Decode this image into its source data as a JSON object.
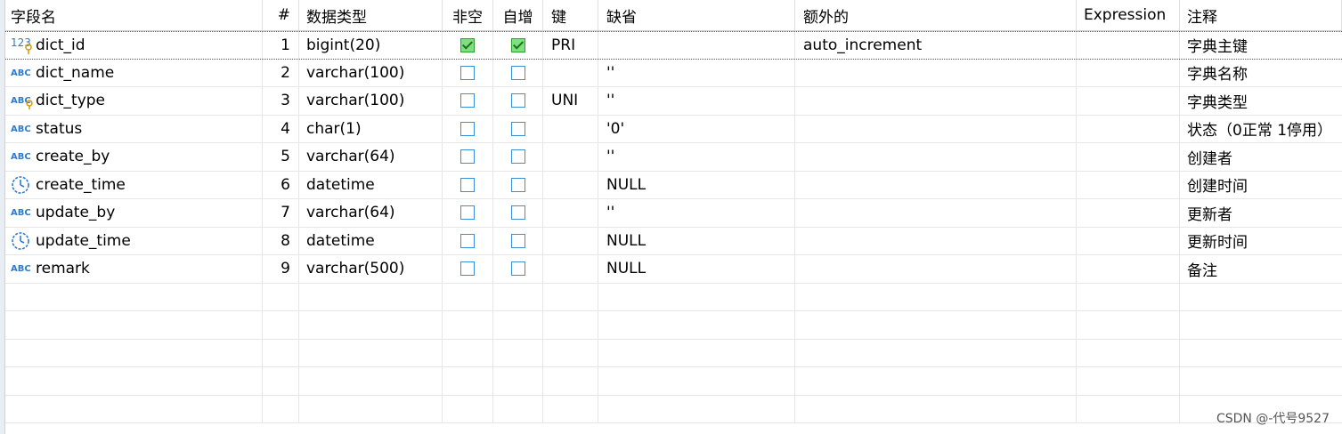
{
  "headers": {
    "name": "字段名",
    "num": "#",
    "type": "数据类型",
    "notnull": "非空",
    "autoinc": "自增",
    "key": "键",
    "default": "缺省",
    "extra": "额外的",
    "expression": "Expression",
    "comment": "注释"
  },
  "rows": [
    {
      "icon": "numeric-key-icon",
      "name": "dict_id",
      "num": "1",
      "type": "bigint(20)",
      "notnull": true,
      "autoinc": true,
      "key": "PRI",
      "default": "",
      "extra": "auto_increment",
      "expression": "",
      "comment": "字典主键"
    },
    {
      "icon": "text-abc-icon",
      "name": "dict_name",
      "num": "2",
      "type": "varchar(100)",
      "notnull": false,
      "autoinc": false,
      "key": "",
      "default": "''",
      "extra": "",
      "expression": "",
      "comment": "字典名称"
    },
    {
      "icon": "text-key-icon",
      "name": "dict_type",
      "num": "3",
      "type": "varchar(100)",
      "notnull": false,
      "autoinc": false,
      "key": "UNI",
      "default": "''",
      "extra": "",
      "expression": "",
      "comment": "字典类型"
    },
    {
      "icon": "text-abc-icon",
      "name": "status",
      "num": "4",
      "type": "char(1)",
      "notnull": false,
      "autoinc": false,
      "key": "",
      "default": "'0'",
      "extra": "",
      "expression": "",
      "comment": "状态（0正常 1停用）"
    },
    {
      "icon": "text-abc-icon",
      "name": "create_by",
      "num": "5",
      "type": "varchar(64)",
      "notnull": false,
      "autoinc": false,
      "key": "",
      "default": "''",
      "extra": "",
      "expression": "",
      "comment": "创建者"
    },
    {
      "icon": "clock-icon",
      "name": "create_time",
      "num": "6",
      "type": "datetime",
      "notnull": false,
      "autoinc": false,
      "key": "",
      "default": "NULL",
      "extra": "",
      "expression": "",
      "comment": "创建时间"
    },
    {
      "icon": "text-abc-icon",
      "name": "update_by",
      "num": "7",
      "type": "varchar(64)",
      "notnull": false,
      "autoinc": false,
      "key": "",
      "default": "''",
      "extra": "",
      "expression": "",
      "comment": "更新者"
    },
    {
      "icon": "clock-icon",
      "name": "update_time",
      "num": "8",
      "type": "datetime",
      "notnull": false,
      "autoinc": false,
      "key": "",
      "default": "NULL",
      "extra": "",
      "expression": "",
      "comment": "更新时间"
    },
    {
      "icon": "text-abc-icon",
      "name": "remark",
      "num": "9",
      "type": "varchar(500)",
      "notnull": false,
      "autoinc": false,
      "key": "",
      "default": "NULL",
      "extra": "",
      "expression": "",
      "comment": "备注"
    }
  ],
  "empty_rows": 5,
  "watermark": "CSDN @-代号9527"
}
